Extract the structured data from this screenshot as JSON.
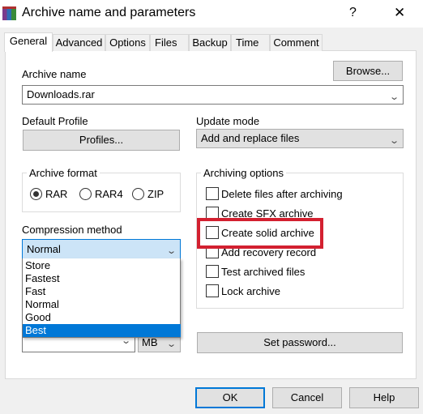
{
  "window": {
    "title": "Archive name and parameters",
    "help": "?",
    "close": "✕"
  },
  "tabs": [
    "General",
    "Advanced",
    "Options",
    "Files",
    "Backup",
    "Time",
    "Comment"
  ],
  "archive_name": {
    "label": "Archive name",
    "value": "Downloads.rar",
    "browse": "Browse..."
  },
  "profile": {
    "label": "Default Profile",
    "button": "Profiles..."
  },
  "update_mode": {
    "label": "Update mode",
    "value": "Add and replace files"
  },
  "archive_format": {
    "label": "Archive format",
    "options": [
      "RAR",
      "RAR4",
      "ZIP"
    ],
    "selected": "RAR"
  },
  "archiving_options": {
    "label": "Archiving options",
    "items": [
      "Delete files after archiving",
      "Create SFX archive",
      "Create solid archive",
      "Add recovery record",
      "Test archived files",
      "Lock archive"
    ],
    "highlight": "Create solid archive",
    "highlight_color": "#d32030"
  },
  "compression": {
    "label": "Compression method",
    "value": "Normal",
    "options": [
      "Store",
      "Fastest",
      "Fast",
      "Normal",
      "Good",
      "Best"
    ],
    "hovered": "Best"
  },
  "split": {
    "value": "",
    "unit": "MB"
  },
  "set_password": "Set password...",
  "buttons": {
    "ok": "OK",
    "cancel": "Cancel",
    "help": "Help"
  },
  "colors": {
    "accent": "#0078d7",
    "select_bg": "#cce4f7"
  }
}
